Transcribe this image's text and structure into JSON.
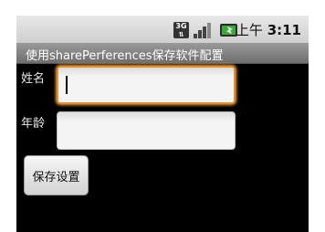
{
  "status_bar": {
    "network_badge": "3G",
    "network_arrows": "⇅",
    "signal_icon": "signal-bars-icon",
    "battery_icon": "battery-charging-icon",
    "time_prefix": "上午",
    "time": "3:11"
  },
  "title_bar": {
    "title": "使用sharePerferences保存软件配置"
  },
  "form": {
    "name_label": "姓名",
    "name_value": "",
    "age_label": "年龄",
    "age_value": "",
    "save_label": "保存设置"
  },
  "colors": {
    "focus_border": "#e88c2a",
    "screen_background": "#000000"
  }
}
